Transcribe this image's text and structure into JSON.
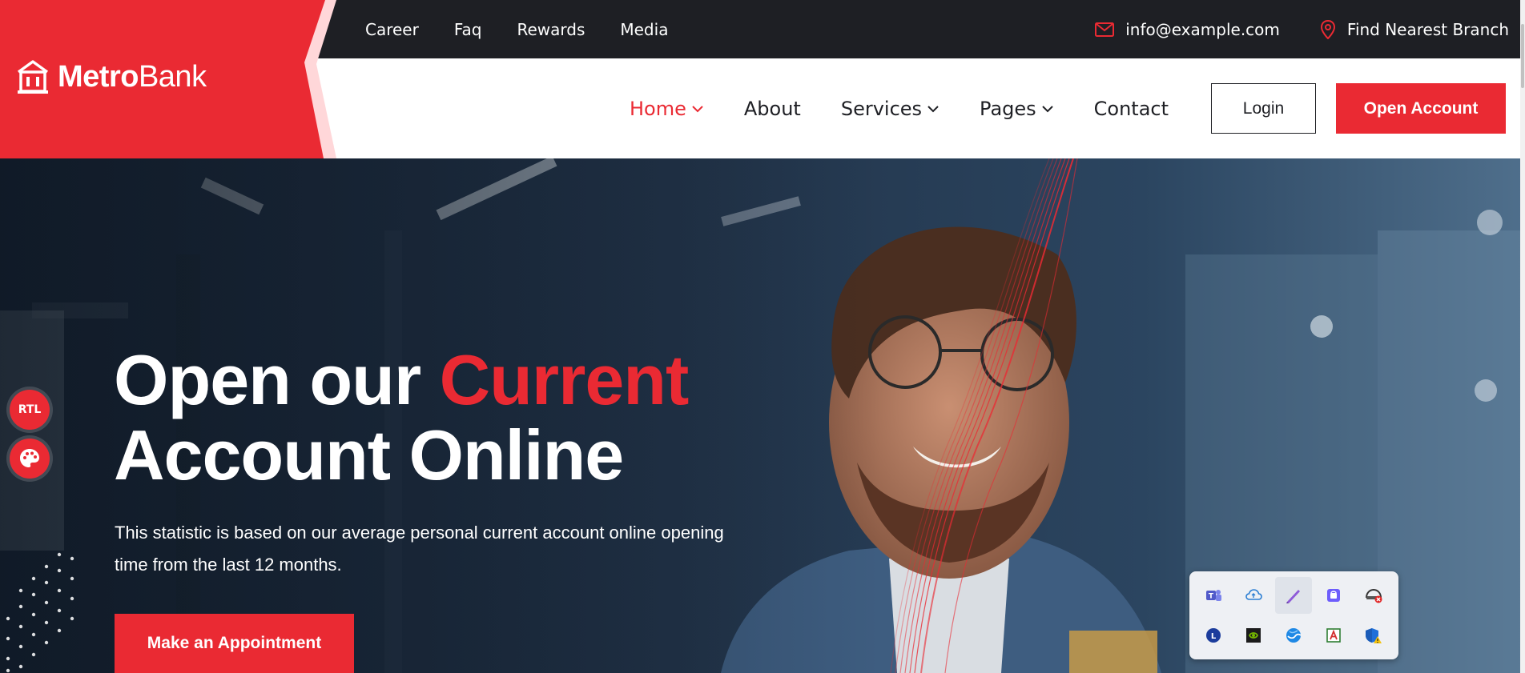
{
  "topbar": {
    "links": [
      "Career",
      "Faq",
      "Rewards",
      "Media"
    ],
    "email": "info@example.com",
    "branch": "Find Nearest Branch"
  },
  "logo": {
    "bold": "Metro",
    "light": "Bank"
  },
  "nav": {
    "home": "Home",
    "about": "About",
    "services": "Services",
    "pages": "Pages",
    "contact": "Contact"
  },
  "buttons": {
    "login": "Login",
    "open_account": "Open Account",
    "appointment": "Make an Appointment"
  },
  "hero": {
    "title_line1_a": "Open our ",
    "title_line1_b": "Current",
    "title_line2": "Account Online",
    "text": "This statistic is based on our average personal current account online opening time from the last 12 months."
  },
  "side": {
    "rtl_label": "RTL"
  },
  "tray_icons": [
    "teams-icon",
    "cloud-icon",
    "pen-icon",
    "store-icon",
    "vpn-error-icon",
    "clock-app-icon",
    "nvidia-icon",
    "browser-icon",
    "pdf-icon",
    "security-warning-icon"
  ],
  "colors": {
    "accent": "#ea2a33",
    "dark": "#1e1f24"
  }
}
